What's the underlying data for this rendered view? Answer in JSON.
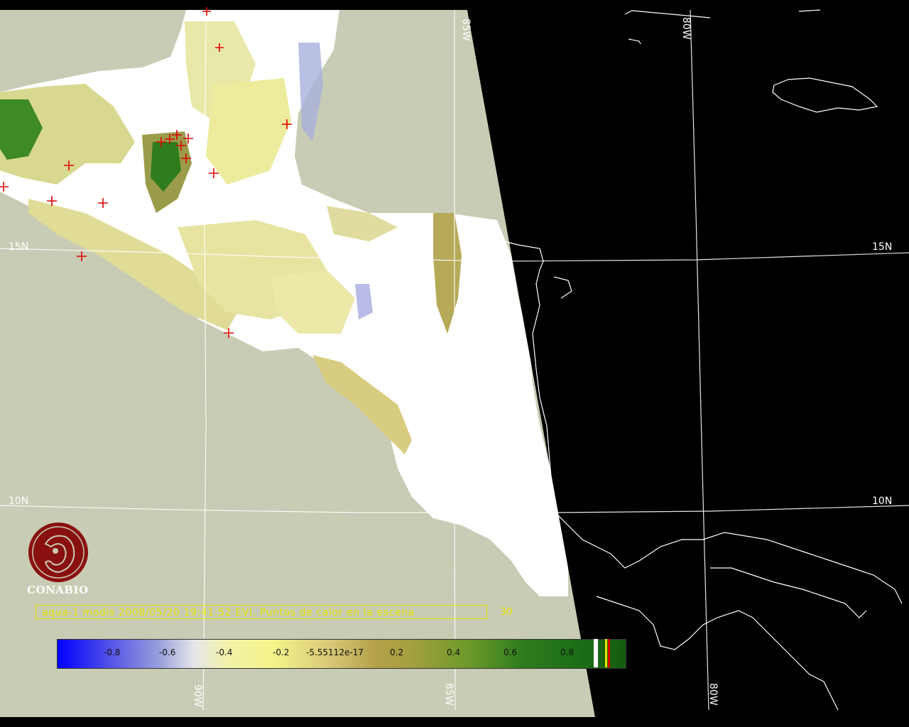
{
  "map": {
    "grid_labels": {
      "lat_15_left": "15N",
      "lat_15_right": "15N",
      "lat_10_left": "10N",
      "lat_10_right": "10N",
      "lon_85_top": "85W",
      "lon_80_top": "80W",
      "lon_90_bottom": "90W",
      "lon_85_bottom": "85W",
      "lon_80_bottom": "80W"
    },
    "colors": {
      "background_ocean": "#c8ccb4",
      "night_side": "#000000",
      "cloud": "#ffffff",
      "fire_marker": "#e00000",
      "grid_line": "#ffffff",
      "caption": "#e8e800"
    },
    "fire_marker_count_label": "30"
  },
  "logo": {
    "text": "CONABIO"
  },
  "caption": {
    "text": "aqua-1 modis 2008/05/20 19:41:52 EVI, Puntos de calor en la escena",
    "count": "30"
  },
  "colorbar": {
    "ticks": [
      "-0.8",
      "-0.6",
      "-0.4",
      "-0.2",
      "-5.55112e-17",
      "0.2",
      "0.4",
      "0.6",
      "0.8"
    ]
  }
}
